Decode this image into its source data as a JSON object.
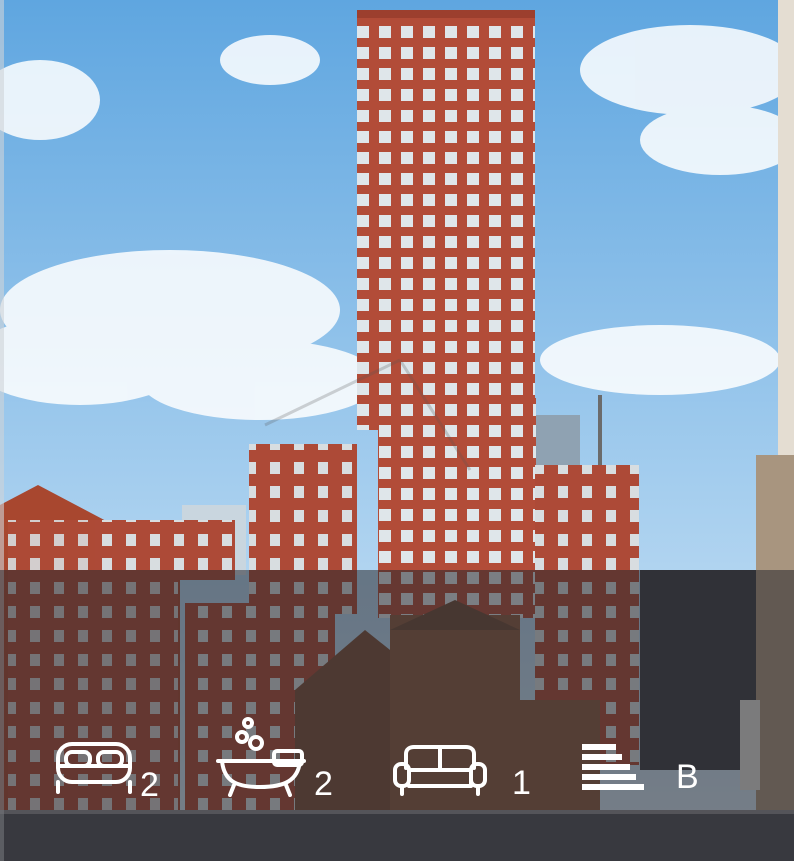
{
  "property_features": {
    "bedrooms": {
      "icon": "bed-icon",
      "value": "2"
    },
    "bathrooms": {
      "icon": "bathtub-icon",
      "value": "2"
    },
    "receptions": {
      "icon": "sofa-icon",
      "value": "1"
    },
    "epc": {
      "icon": "epc-rating-icon",
      "value": "B"
    }
  },
  "colors": {
    "sky": "#7fb9e6",
    "brick": "#b8503c",
    "overlay": "rgba(40,40,45,0.55)",
    "icon": "#ffffff"
  }
}
